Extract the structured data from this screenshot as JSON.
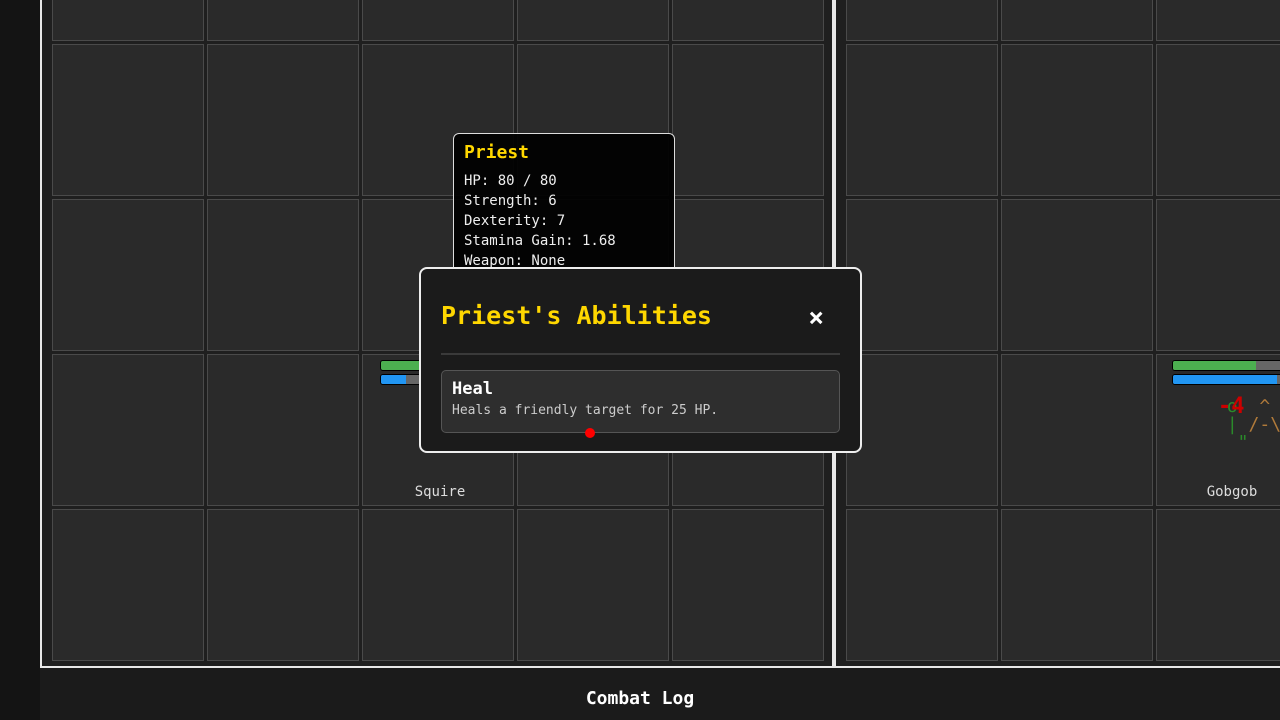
{
  "units": {
    "squire": {
      "name": "Squire",
      "hp_fraction": 1.0,
      "stamina_fraction": 0.21
    },
    "gobgob": {
      "name": "Gobgob",
      "hp_fraction": 0.7,
      "stamina_fraction": 0.88,
      "damage_text": "-4"
    }
  },
  "tooltip": {
    "title": "Priest",
    "lines": [
      "HP: 80 / 80",
      "Strength: 6",
      "Dexterity: 7",
      "Stamina Gain: 1.68",
      "Weapon: None"
    ]
  },
  "modal": {
    "title": "Priest's Abilities",
    "close": "×",
    "abilities": [
      {
        "name": "Heal",
        "description": "Heals a friendly target for 25 HP."
      }
    ]
  },
  "combat_log": {
    "title": "Combat Log"
  },
  "colors": {
    "hp": "#4caf50",
    "stamina": "#2196f3",
    "accent": "#ffd700"
  }
}
